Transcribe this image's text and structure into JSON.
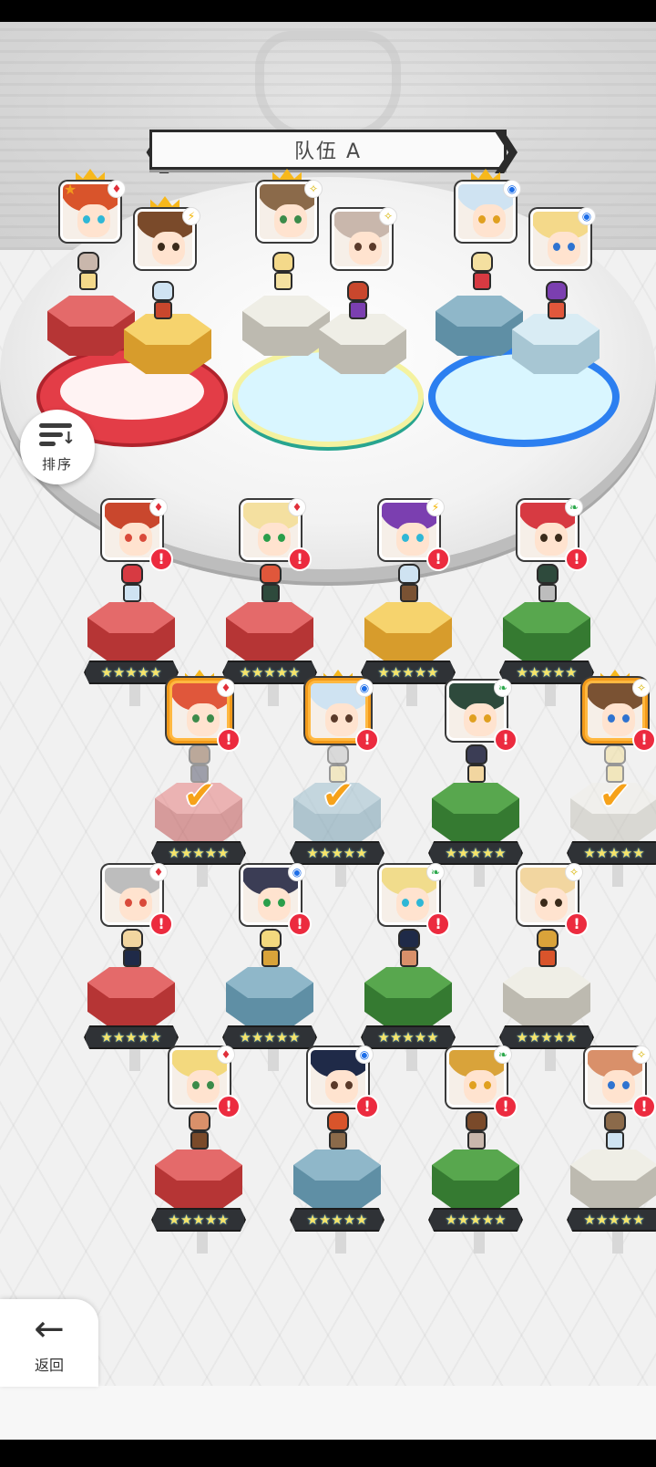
{
  "team": {
    "title": "队伍 A"
  },
  "sort_button": {
    "label": "排序"
  },
  "back_button": {
    "label": "返回"
  },
  "banner": {
    "prev_glyph": "❮",
    "next_glyph": "❯"
  },
  "team_slots": [
    {
      "element": "fire",
      "element_glyph": "♦",
      "leader": true,
      "pedestal": "red"
    },
    {
      "element": "thunder",
      "element_glyph": "⚡",
      "leader": true,
      "pedestal": "gold"
    },
    {
      "element": "light",
      "element_glyph": "✧",
      "leader": true,
      "pedestal": "white"
    },
    {
      "element": "light",
      "element_glyph": "✧",
      "leader": false,
      "pedestal": "white"
    },
    {
      "element": "water",
      "element_glyph": "◉",
      "leader": true,
      "pedestal": "steel"
    },
    {
      "element": "water",
      "element_glyph": "◉",
      "leader": false,
      "pedestal": "ice"
    }
  ],
  "roster": [
    {
      "element": "fire",
      "element_glyph": "♦",
      "pedestal": "red",
      "stars": "★★★★★",
      "alert": "!"
    },
    {
      "element": "fire",
      "element_glyph": "♦",
      "pedestal": "red",
      "stars": "★★★★★",
      "alert": "!"
    },
    {
      "element": "thunder",
      "element_glyph": "⚡",
      "pedestal": "gold",
      "stars": "★★★★★",
      "alert": "!"
    },
    {
      "element": "nature",
      "element_glyph": "❧",
      "pedestal": "green",
      "stars": "★★★★★",
      "alert": "!"
    },
    {
      "element": "fire",
      "element_glyph": "♦",
      "pedestal": "red",
      "stars": "★★★★★",
      "alert": "!",
      "in_team": true,
      "check": "✔"
    },
    {
      "element": "water",
      "element_glyph": "◉",
      "pedestal": "steel",
      "stars": "★★★★★",
      "alert": "!",
      "in_team": true,
      "check": "✔"
    },
    {
      "element": "nature",
      "element_glyph": "❧",
      "pedestal": "green",
      "stars": "★★★★★",
      "alert": "!"
    },
    {
      "element": "light",
      "element_glyph": "✧",
      "pedestal": "white",
      "stars": "★★★★★",
      "alert": "!",
      "in_team": true,
      "check": "✔"
    },
    {
      "element": "fire",
      "element_glyph": "♦",
      "pedestal": "red",
      "stars": "★★★★★",
      "alert": "!"
    },
    {
      "element": "water",
      "element_glyph": "◉",
      "pedestal": "steel",
      "stars": "★★★★★",
      "alert": "!"
    },
    {
      "element": "nature",
      "element_glyph": "❧",
      "pedestal": "green",
      "stars": "★★★★★",
      "alert": "!"
    },
    {
      "element": "light",
      "element_glyph": "✧",
      "pedestal": "white",
      "stars": "★★★★★",
      "alert": "!"
    },
    {
      "element": "fire",
      "element_glyph": "♦",
      "pedestal": "red",
      "stars": "★★★★★",
      "alert": "!"
    },
    {
      "element": "water",
      "element_glyph": "◉",
      "pedestal": "steel",
      "stars": "★★★★★",
      "alert": "!"
    },
    {
      "element": "nature",
      "element_glyph": "❧",
      "pedestal": "green",
      "stars": "★★★★★",
      "alert": "!"
    },
    {
      "element": "light",
      "element_glyph": "✧",
      "pedestal": "white",
      "stars": "★★★★★",
      "alert": "!"
    }
  ],
  "colors": {
    "fire": "#e0303a",
    "water": "#1d6ee8",
    "nature": "#2aa84a",
    "light": "#d8b400",
    "thunder": "#f3b400",
    "selected_border": "#f29a1a"
  }
}
